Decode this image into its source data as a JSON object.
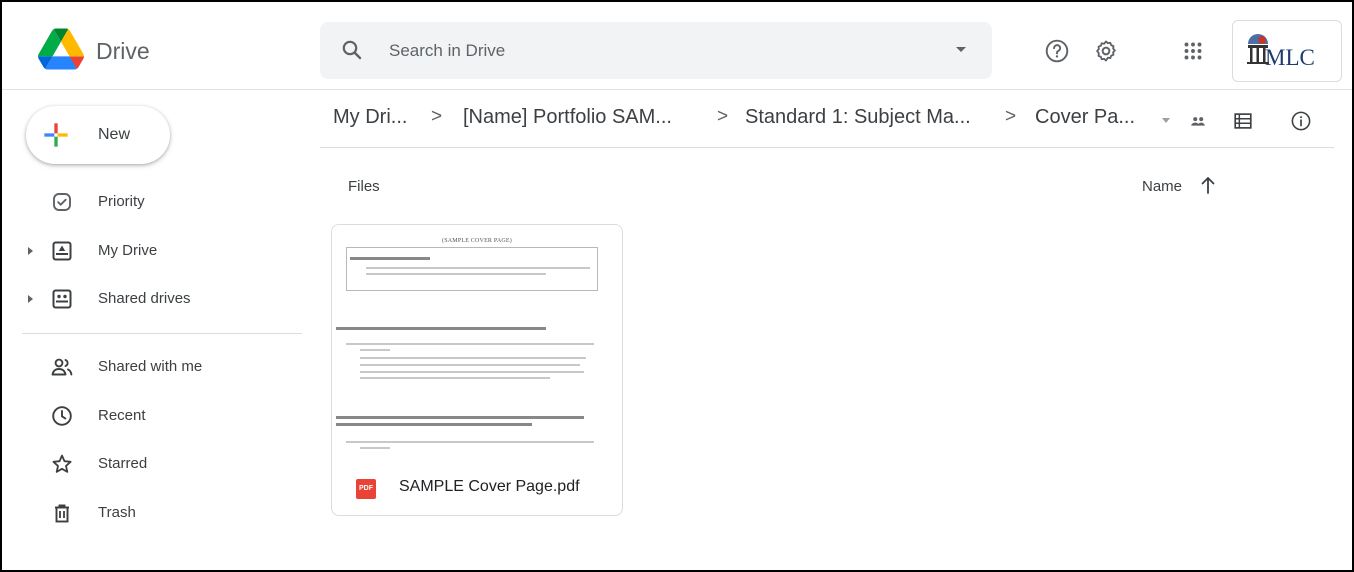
{
  "app": {
    "name": "Drive",
    "logo_icon": "google-drive-logo",
    "account_label": "MLC"
  },
  "search": {
    "placeholder": "Search in Drive",
    "icon": "search-icon"
  },
  "header_actions": [
    {
      "icon": "help-icon"
    },
    {
      "icon": "settings-icon"
    },
    {
      "icon": "apps-grid-icon"
    }
  ],
  "sidebar": {
    "new_button": "New",
    "items": [
      {
        "label": "Priority",
        "icon": "priority-check-icon",
        "expandable": false
      },
      {
        "label": "My Drive",
        "icon": "my-drive-icon",
        "expandable": true
      },
      {
        "label": "Shared drives",
        "icon": "shared-drives-icon",
        "expandable": true
      },
      {
        "label": "Shared with me",
        "icon": "shared-with-me-icon",
        "expandable": false
      },
      {
        "label": "Recent",
        "icon": "clock-icon",
        "expandable": false
      },
      {
        "label": "Starred",
        "icon": "star-icon",
        "expandable": false
      },
      {
        "label": "Trash",
        "icon": "trash-icon",
        "expandable": false
      }
    ]
  },
  "breadcrumb": {
    "items": [
      "My Dri...",
      "[Name] Portfolio SAM...",
      "Standard 1: Subject Ma...",
      "Cover Pa..."
    ],
    "separator": ">"
  },
  "toolbar_actions": [
    {
      "icon": "share-people-icon"
    },
    {
      "icon": "list-view-icon"
    },
    {
      "icon": "info-icon"
    }
  ],
  "main": {
    "section_label": "Files",
    "sort_label": "Name",
    "sort_direction": "ascending"
  },
  "files": [
    {
      "name": "SAMPLE Cover Page.pdf",
      "type_label": "PDF",
      "thumbnail_title": "(SAMPLE COVER PAGE)"
    }
  ],
  "colors": {
    "accent": "#1a73e8",
    "pdf_red": "#ea4335",
    "search_bg": "#f1f3f4",
    "border": "#dadce0"
  }
}
